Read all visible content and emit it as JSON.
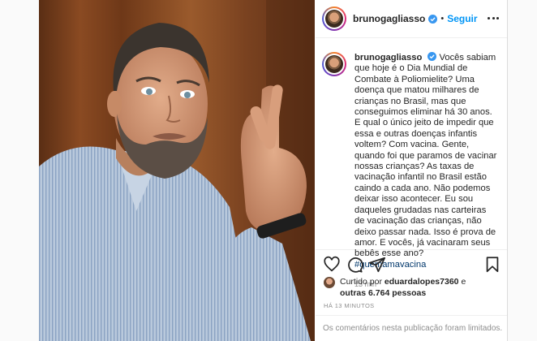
{
  "post": {
    "username": "brunogagliasso",
    "follow_label": "Seguir",
    "separator": "•",
    "caption": "Vocês sabiam que hoje é o Dia Mundial de Combate à Poliomielite? Uma doença que matou milhares de crianças no Brasil, mas que conseguimos eliminar há 30 anos. E qual o único jeito de impedir que essa e outras doenças infantis voltem? Com vacina. Gente, quando foi que paramos de vacinar nossas crianças? As taxas de vacinação infantil no Brasil estão caindo a cada ano. Não podemos deixar isso acontecer. Eu sou daqueles grudadas nas carteiras de vacinação das crianças, não deixo passar nada. Isso é prova de amor. E vocês, já vacinaram seus bebês esse ano?",
    "hashtag": "#quemamavacina",
    "time_ago": "13 min"
  },
  "likes": {
    "prefix": "Curtido por",
    "liker": "eduardalopes7360",
    "connector": "e",
    "others": "outras 6.764 pessoas"
  },
  "timestamp": "HÁ 13 MINUTOS",
  "comments_disabled": "Os comentários nesta publicação foram limitados.",
  "colors": {
    "accent": "#0095f6",
    "hashtag": "#00376b",
    "muted": "#8e8e8e",
    "text": "#262626"
  },
  "icons": [
    "verified-icon",
    "more-options-icon",
    "heart-icon",
    "comment-icon",
    "share-icon",
    "bookmark-icon"
  ]
}
